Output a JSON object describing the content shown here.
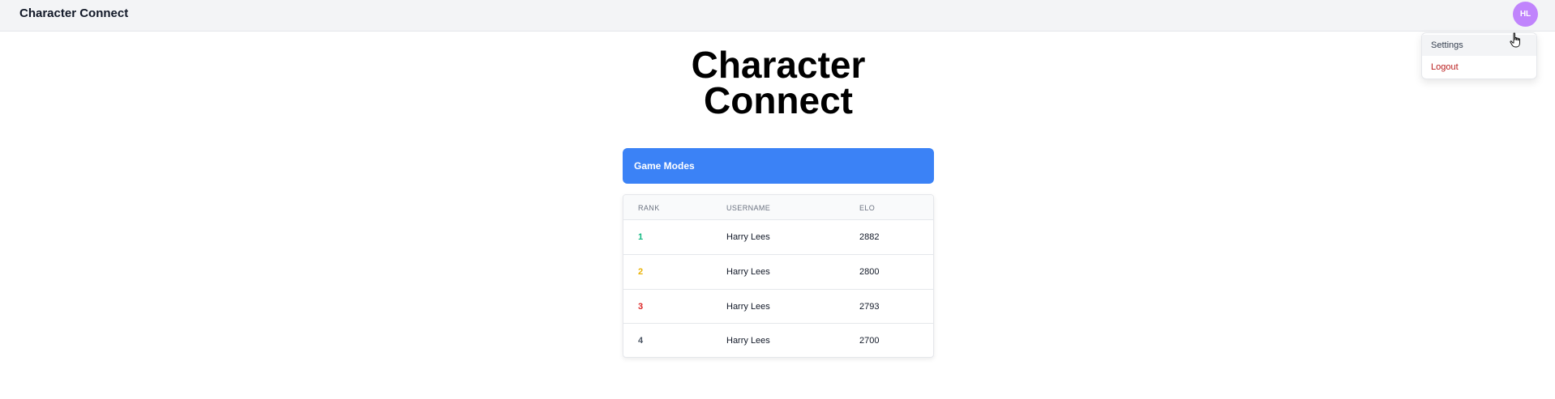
{
  "app": {
    "brand": "Character Connect"
  },
  "user_menu": {
    "avatar_initials": "HL",
    "items": [
      {
        "label": "Settings"
      },
      {
        "label": "Logout"
      }
    ]
  },
  "hero": {
    "line1": "Character",
    "line2": "Connect"
  },
  "game_modes": {
    "label": "Game Modes"
  },
  "leaderboard": {
    "headers": [
      "RANK",
      "USERNAME",
      "ELO"
    ],
    "rows": [
      {
        "rank": "1",
        "username": "Harry Lees",
        "elo": "2882",
        "rank_color": "#10b981"
      },
      {
        "rank": "2",
        "username": "Harry Lees",
        "elo": "2800",
        "rank_color": "#eab308"
      },
      {
        "rank": "3",
        "username": "Harry Lees",
        "elo": "2793",
        "rank_color": "#dc2626"
      },
      {
        "rank": "4",
        "username": "Harry Lees",
        "elo": "2700",
        "rank_color": "#4b5563"
      }
    ]
  },
  "colors": {
    "accent": "#3b82f6",
    "avatar": "#c084fc",
    "logout": "#b91c1c"
  }
}
